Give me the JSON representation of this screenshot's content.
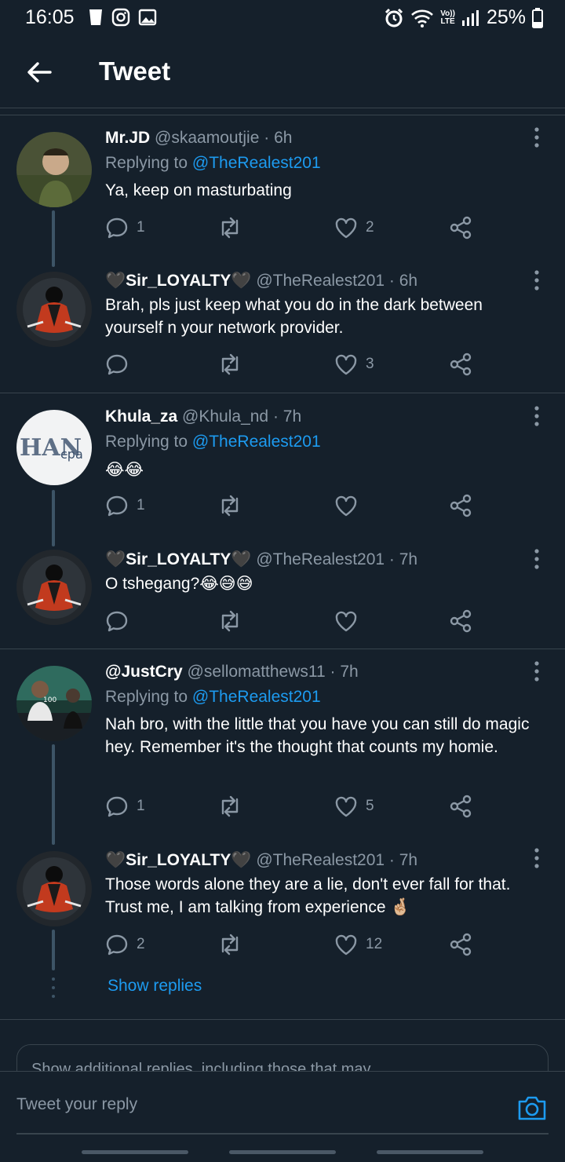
{
  "status_bar": {
    "time": "16:05",
    "battery": "25%",
    "lte_top": "Vo))",
    "lte_bottom": "LTE"
  },
  "header": {
    "title": "Tweet"
  },
  "tweets": [
    {
      "name": "Mr.JD",
      "handle": "@skaamoutjie · 6h",
      "replying_prefix": "Replying to ",
      "replying_to": "@TheRealest201",
      "text": "Ya, keep on masturbating",
      "replies": "1",
      "retweets": "",
      "likes": "2"
    },
    {
      "name": "🖤Sir_LOYALTY🖤",
      "handle": "@TheRealest201 · 6h",
      "text": "Brah, pls just keep what you do in the dark between yourself n your network provider.",
      "replies": "",
      "retweets": "",
      "likes": "3"
    },
    {
      "name": "Khula_za",
      "handle": "@Khula_nd · 7h",
      "replying_prefix": "Replying to ",
      "replying_to": "@TheRealest201",
      "text": "😂😂",
      "replies": "1",
      "retweets": "",
      "likes": ""
    },
    {
      "name": "🖤Sir_LOYALTY🖤",
      "handle": "@TheRealest201 · 7h",
      "text": "O tshegang?😂😅😅",
      "replies": "",
      "retweets": "",
      "likes": ""
    },
    {
      "name": "@JustCry",
      "handle": "@sellomatthews11 · 7h",
      "replying_prefix": "Replying to ",
      "replying_to": "@TheRealest201",
      "text": "Nah bro, with the little that you have you can still do magic hey. Remember it's the thought that counts my homie.",
      "replies": "1",
      "retweets": "",
      "likes": "5"
    },
    {
      "name": "🖤Sir_LOYALTY🖤",
      "handle": "@TheRealest201 · 7h",
      "text": "Those words alone they are a lie, don't ever fall for that. Trust me, I am talking from experience 🤞🏼",
      "replies": "2",
      "retweets": "",
      "likes": "12"
    }
  ],
  "show_replies": "Show replies",
  "additional_replies": "Show additional replies, including those that may",
  "reply_placeholder": "Tweet your reply",
  "colors": {
    "background": "#15202b",
    "accent": "#1d9bf0",
    "muted": "#8b98a5",
    "divider": "#38444d"
  },
  "icons": [
    "back-arrow-icon",
    "more-vertical-icon",
    "reply-icon",
    "retweet-icon",
    "like-icon",
    "share-icon",
    "camera-icon"
  ]
}
